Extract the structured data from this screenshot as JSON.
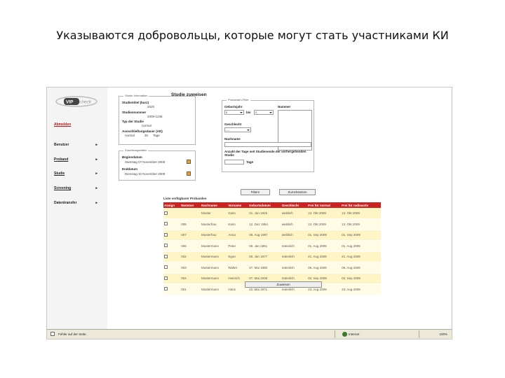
{
  "slide_title": "Указываются добровольцы, которые могут стать участниками КИ",
  "app": {
    "logo_text": "VIPcheck",
    "page_heading": "Studie zuweisen"
  },
  "sidebar": {
    "items": [
      {
        "label": "Abmelden",
        "arrow": ""
      },
      {
        "label": "Benutzer",
        "arrow": "▸"
      },
      {
        "label": "Proband",
        "arrow": "▸"
      },
      {
        "label": "Studie",
        "arrow": "▸"
      },
      {
        "label": "Screening",
        "arrow": "▸"
      },
      {
        "label": "Datentransfer",
        "arrow": "▸"
      }
    ]
  },
  "study_info": {
    "legend": "Studie Information",
    "title_label": "Studientitel (kurz)",
    "title_value": "2020",
    "number_label": "Studiennummer",
    "number_value": "2009-1235",
    "type_label": "Typ der Studie",
    "type_value": "normal",
    "exclusion_label": "Ausschließungsdauer (AD)",
    "exclusion_type": "normal",
    "exclusion_days": "30",
    "exclusion_unit": "Tage"
  },
  "period": {
    "legend": "Zuweisungsdaten",
    "start_label": "Beginndatum",
    "start_value": "Samstag 07 November 2009",
    "end_label": "Enddatum",
    "end_value": "Dienstag 10 November 2009"
  },
  "filter": {
    "legend": "Probanden-Filter",
    "birth_label": "Geburtsjahr",
    "birth_from": "0",
    "birth_to_label": "bis",
    "birth_to": "0",
    "number_label": "Nummer",
    "gender_label": "Geschlecht",
    "gender_value": "----",
    "lastname_label": "Nachname",
    "lastname_value": "",
    "days_label": "Anzahl der Tage seit Studienende der vorhergehenden Studie",
    "days_value": "",
    "days_unit": "Tage"
  },
  "buttons": {
    "filter": "Filtern",
    "reset": "Zurücksetzen",
    "assign": "Zuweisen"
  },
  "table": {
    "caption": "Liste verfügbarer Probanden",
    "columns": [
      "Assign",
      "Nummer",
      "Nachname",
      "Vorname",
      "Geburtsdatum",
      "Geschlecht",
      "Frei für normal",
      "Frei für radioactiv"
    ],
    "rows": [
      [
        "",
        "",
        "Muster",
        "Karin",
        "01. Jan 1946",
        "weiblich",
        "13. Okt 2009",
        "13. Okt 2009"
      ],
      [
        "",
        "005",
        "Musterfrau",
        "Karin",
        "12. Dez 1954",
        "weiblich",
        "13. Okt 2009",
        "13. Okt 2009"
      ],
      [
        "",
        "007",
        "Musterfrau",
        "Anna",
        "08. Aug 1987",
        "weiblich",
        "01. Sep 2009",
        "01. Sep 2009"
      ],
      [
        "",
        "006",
        "Mustermann",
        "Peter",
        "06. Jan 1951",
        "männlich",
        "01. Aug 2009",
        "01. Aug 2009"
      ],
      [
        "",
        "002",
        "Mustermann",
        "Egon",
        "05. Jan 1977",
        "männlich",
        "21. Aug 2009",
        "21. Aug 2009"
      ],
      [
        "",
        "003",
        "Mustermann",
        "Walter",
        "07. Mai 1980",
        "männlich",
        "08. Aug 2009",
        "08. Aug 2009"
      ],
      [
        "",
        "004",
        "Mustermann",
        "Heinrich",
        "07. Mai 1938",
        "männlich",
        "04. Sep 2009",
        "04. Sep 2009"
      ],
      [
        "",
        "001",
        "Mustermann",
        "Hans",
        "22. Mai 1971",
        "männlich",
        "23. Aug 2009",
        "23. Aug 2009"
      ]
    ]
  },
  "statusbar": {
    "text": "Fehler auf der Seite.",
    "zone": "Internet",
    "zoom": "100%"
  },
  "colors": {
    "table_header": "#cc2222",
    "row_odd": "#fff4c4",
    "row_even": "#fffbe4",
    "link_red": "#c01010"
  }
}
